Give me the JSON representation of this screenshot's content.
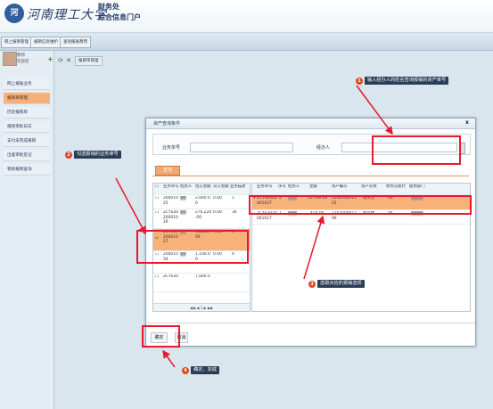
{
  "header": {
    "logo_text": "河",
    "university": "河南理工大学",
    "department": "财务处",
    "portal": "综合信息门户"
  },
  "topnav": [
    "网上报销管理",
    "报销信息维护",
    "查询报账费用"
  ],
  "sidebar": {
    "user_name": "教师",
    "user_role": "欢迎您",
    "items": [
      {
        "label": "网上报账业务"
      },
      {
        "label": "报销单管理"
      },
      {
        "label": "历史报销单"
      },
      {
        "label": "报销审批日志"
      },
      {
        "label": "支付未完成报销"
      },
      {
        "label": "出差审批登记"
      },
      {
        "label": "物资报销查询"
      }
    ]
  },
  "content_tab": "报销单管理",
  "annotations": {
    "step1": {
      "num": "1",
      "text": "输入经办人的姓名查询报销的资产单号"
    },
    "step2": {
      "num": "2",
      "text": "勾选报销的业务单号"
    },
    "step3": {
      "num": "3",
      "text": "选取对应的报销选项"
    },
    "step4": {
      "num": "4",
      "text": "确定，完成"
    }
  },
  "dialog": {
    "title": "资产查询条件",
    "close": "x",
    "biz_no_label": "业务单号",
    "handler_label": "经办人",
    "query_button": "查询",
    "ok_button": "确定",
    "cancel_button": "取消",
    "left_grid": {
      "headers": [
        "业务单号",
        "经办人",
        "借方金额",
        "贷方金额",
        "业务描述"
      ],
      "rows": [
        {
          "no": "200010\n25",
          "handler": "",
          "debit": "2,000.0\n0",
          "credit": "0.00",
          "desc": "1"
        },
        {
          "no": "ZCYS20\n200010\n26",
          "handler": "",
          "debit": "276,220\n.00",
          "credit": "0.00",
          "desc": "34"
        },
        {
          "no": "ZCYS20\n200010\n27",
          "handler": "",
          "debit": "11,200.\n00",
          "credit": "0.00",
          "desc": "3"
        },
        {
          "no": "200010\n34",
          "handler": "",
          "debit": "1,100.0\n0",
          "credit": "0.00",
          "desc": "6"
        },
        {
          "no": "ZCYS20\n",
          "handler": "",
          "debit": "7,000.0",
          "credit": "",
          "desc": ""
        }
      ],
      "pager": "◀◀ ◀ 1 ▶ ▶▶"
    },
    "right_grid": {
      "headers": [
        "业务单号",
        "序号",
        "经办人",
        "金额",
        "资产编号",
        "资产名称",
        "财务分类代",
        "使用部门"
      ],
      "rows": [
        {
          "no": "ZCYS2020\n001027",
          "seq": "2",
          "handler": "",
          "amount": "10,780.00",
          "asset_no": "1202000015\n25",
          "asset_name": "救灾包",
          "cat": "06",
          "dept": ""
        },
        {
          "no": "ZCYS2020\n001027",
          "seq": "1",
          "handler": "",
          "amount": "420.00",
          "asset_no": "1202000015\n90",
          "asset_name": "会议椅",
          "cat": "06",
          "dept": ""
        }
      ]
    }
  },
  "colors": {
    "accent_orange": "#f7b27a",
    "annotation_red": "#e8192c",
    "badge": "#e0471e",
    "label_bg": "#2a3d57"
  }
}
